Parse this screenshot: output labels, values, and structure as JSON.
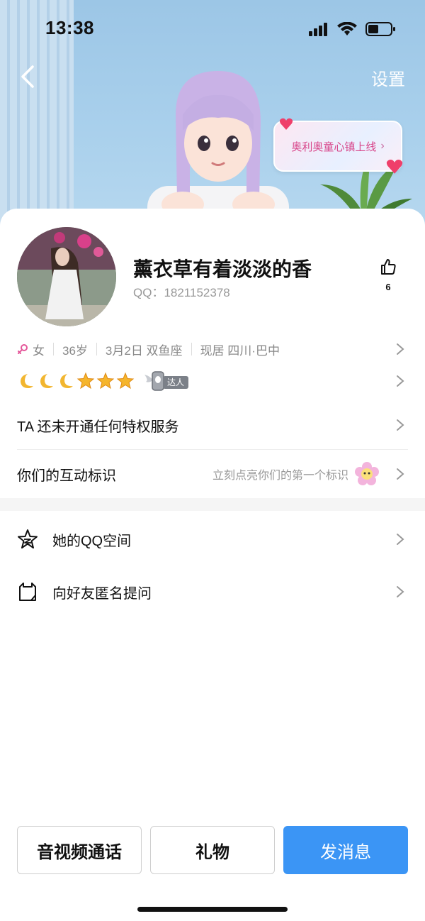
{
  "status_bar": {
    "time": "13:38"
  },
  "header": {
    "settings_label": "设置",
    "promo_bubble": {
      "text": "奥利奥童心镇上线",
      "chevron": "›"
    }
  },
  "profile": {
    "nickname": "薰衣草有着淡淡的香",
    "qq_label": "QQ：1821152378",
    "like_count": "6",
    "gender_icon": "female-icon",
    "gender": "女",
    "age": "36岁",
    "birthday_zodiac": "3月2日 双鱼座",
    "location": "现居 四川·巴中",
    "levels": [
      "moon",
      "moon",
      "moon",
      "star",
      "star",
      "star"
    ],
    "badge_label": "达人"
  },
  "rows": {
    "privilege": "TA 还未开通任何特权服务",
    "interaction_label": "你们的互动标识",
    "interaction_hint": "立刻点亮你们的第一个标识"
  },
  "list": [
    {
      "icon": "qzone-star-icon",
      "label": "她的QQ空间"
    },
    {
      "icon": "anonymous-question-icon",
      "label": "向好友匿名提问"
    }
  ],
  "actions": {
    "call": "音视频通话",
    "gift": "礼物",
    "message": "发消息"
  },
  "colors": {
    "accent": "#3b95f5",
    "bubble_text": "#d8468a"
  }
}
